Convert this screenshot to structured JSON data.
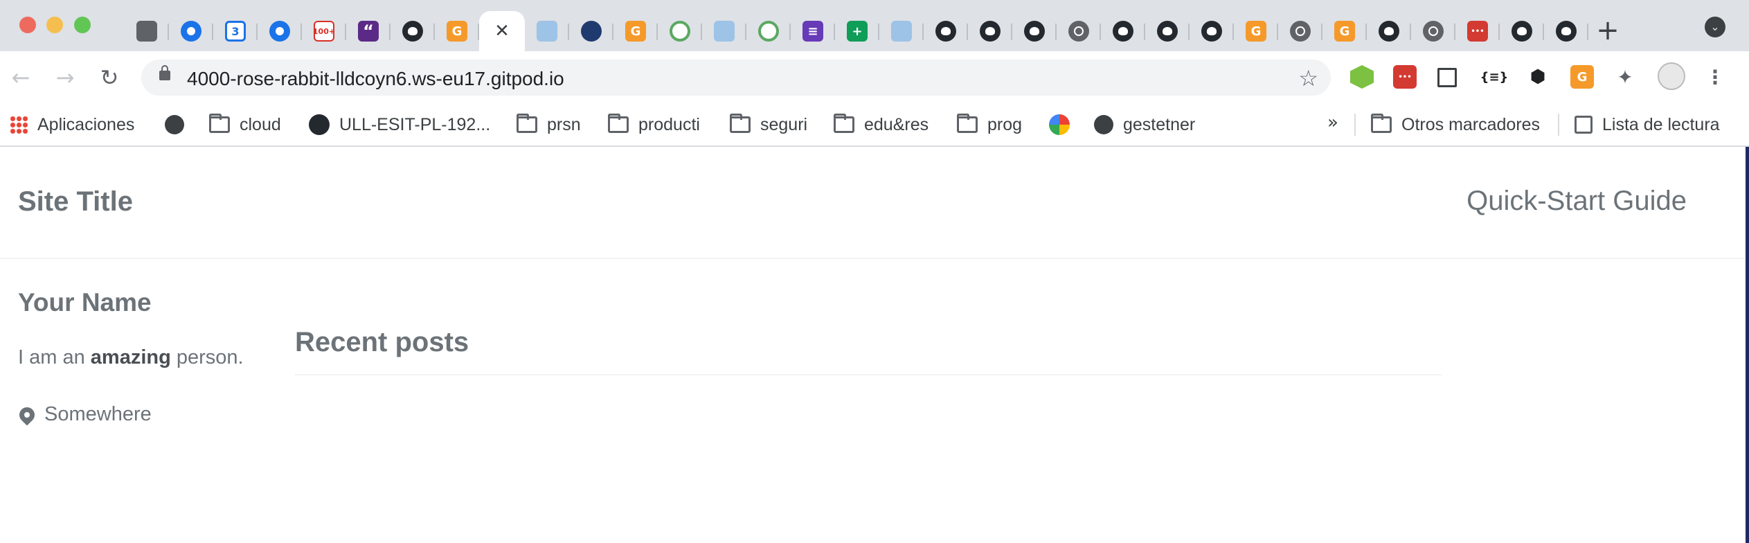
{
  "browser": {
    "tabs": [
      {
        "icon": "chat-icon",
        "active": false
      },
      {
        "icon": "contacts-icon",
        "active": false
      },
      {
        "icon": "google-calendar-icon",
        "active": false
      },
      {
        "icon": "contacts-icon",
        "active": false
      },
      {
        "icon": "gmail-icon",
        "badge": "100+",
        "active": false
      },
      {
        "icon": "quote-icon",
        "active": false
      },
      {
        "icon": "github-icon",
        "active": false
      },
      {
        "icon": "gitpod-icon",
        "active": false
      },
      {
        "icon": "close-icon",
        "active": true
      },
      {
        "icon": "cloud-icon",
        "active": false
      },
      {
        "icon": "university-icon",
        "active": false
      },
      {
        "icon": "gitpod-icon",
        "active": false
      },
      {
        "icon": "github-green-icon",
        "active": false
      },
      {
        "icon": "cloud-icon",
        "active": false
      },
      {
        "icon": "github-green-icon",
        "active": false
      },
      {
        "icon": "google-forms-icon",
        "active": false
      },
      {
        "icon": "google-sheets-icon",
        "active": false
      },
      {
        "icon": "cloud-icon",
        "active": false
      },
      {
        "icon": "github-icon",
        "active": false
      },
      {
        "icon": "github-icon",
        "active": false
      },
      {
        "icon": "github-icon",
        "active": false
      },
      {
        "icon": "globe-icon",
        "active": false
      },
      {
        "icon": "github-icon",
        "active": false
      },
      {
        "icon": "github-icon",
        "active": false
      },
      {
        "icon": "github-icon",
        "active": false
      },
      {
        "icon": "gitpod-icon",
        "active": false
      },
      {
        "icon": "globe-icon",
        "active": false
      },
      {
        "icon": "gitpod-icon",
        "active": false
      },
      {
        "icon": "github-icon",
        "active": false
      },
      {
        "icon": "globe-icon",
        "active": false
      },
      {
        "icon": "red-dots-icon",
        "active": false
      },
      {
        "icon": "github-icon",
        "active": false
      },
      {
        "icon": "github-icon",
        "active": false
      }
    ],
    "url": "4000-rose-rabbit-lldcoyn6.ws-eu17.gitpod.io",
    "bookmarks": {
      "apps": "Aplicaciones",
      "cloud": "cloud",
      "ull": "ULL-ESIT-PL-192...",
      "prsn": "prsn",
      "producti": "producti",
      "seguri": "seguri",
      "edures": "edu&res",
      "prog": "prog",
      "gestetner": "gestetner",
      "more": "»",
      "other": "Otros marcadores",
      "reading": "Lista de lectura"
    }
  },
  "site": {
    "title": "Site Title",
    "nav_link": "Quick-Start Guide",
    "author": {
      "name": "Your Name",
      "bio_prefix": "I am an ",
      "bio_strong": "amazing",
      "bio_suffix": " person.",
      "location": "Somewhere"
    },
    "section_title": "Recent posts"
  },
  "colors": {
    "tabstrip": "#dee1e6",
    "text_muted": "#6c7378",
    "accent_red": "#d33a32",
    "accent_orange": "#f59a2a"
  }
}
